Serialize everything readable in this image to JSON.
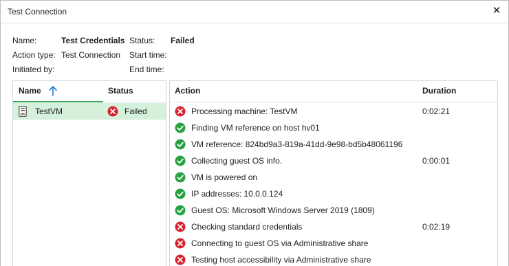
{
  "window": {
    "title": "Test Connection",
    "close_label": "✕"
  },
  "info": {
    "name_label": "Name:",
    "name_value": "Test Credentials",
    "action_type_label": "Action type:",
    "action_type_value": "Test Connection",
    "initiated_by_label": "Initiated by:",
    "initiated_by_value": "",
    "status_label": "Status:",
    "status_value": "Failed",
    "start_time_label": "Start time:",
    "start_time_value": "",
    "end_time_label": "End time:",
    "end_time_value": ""
  },
  "vm_table": {
    "columns": {
      "name": "Name",
      "status": "Status"
    },
    "sort": {
      "column": "name",
      "direction": "ascending"
    },
    "rows": [
      {
        "name": "TestVM",
        "status": "Failed",
        "status_icon": "error-icon",
        "icon": "vm-icon"
      }
    ]
  },
  "action_table": {
    "columns": {
      "action": "Action",
      "duration": "Duration"
    },
    "rows": [
      {
        "status": "error",
        "action": "Processing machine: TestVM",
        "duration": "0:02:21"
      },
      {
        "status": "success",
        "action": "Finding VM reference on host hv01",
        "duration": ""
      },
      {
        "status": "success",
        "action": "VM reference: 824bd9a3-819a-41dd-9e98-bd5b48061196",
        "duration": ""
      },
      {
        "status": "success",
        "action": "Collecting guest OS info.",
        "duration": "0:00:01"
      },
      {
        "status": "success",
        "action": "VM is powered on",
        "duration": ""
      },
      {
        "status": "success",
        "action": "IP addresses: 10.0.0.124",
        "duration": ""
      },
      {
        "status": "success",
        "action": "Guest OS: Microsoft Windows Server 2019 (1809)",
        "duration": ""
      },
      {
        "status": "error",
        "action": "Checking standard credentials",
        "duration": "0:02:19"
      },
      {
        "status": "error",
        "action": "Connecting to guest OS via Administrative share",
        "duration": ""
      },
      {
        "status": "error",
        "action": "Testing host accessibility via Administrative share",
        "duration": ""
      }
    ]
  },
  "colors": {
    "success": "#27a243",
    "error": "#d6232f",
    "selected_row": "#d5f0db",
    "sort_accent": "#37a559",
    "sort_arrow": "#1f7fd6"
  }
}
